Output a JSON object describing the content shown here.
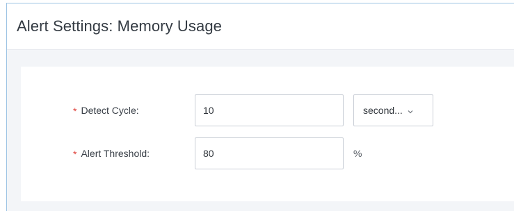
{
  "dialog": {
    "title": "Alert Settings: Memory Usage"
  },
  "form": {
    "detect_cycle": {
      "required_mark": "*",
      "label": "Detect Cycle:",
      "value": "10",
      "unit_select": {
        "selected": "second...",
        "icon": "chevron-down-icon"
      }
    },
    "alert_threshold": {
      "required_mark": "*",
      "label": "Alert Threshold:",
      "value": "80",
      "unit": "%"
    }
  },
  "colors": {
    "required": "#e0443e",
    "border_accent": "#9cc3e4",
    "body_bg": "#f3f5f8"
  }
}
